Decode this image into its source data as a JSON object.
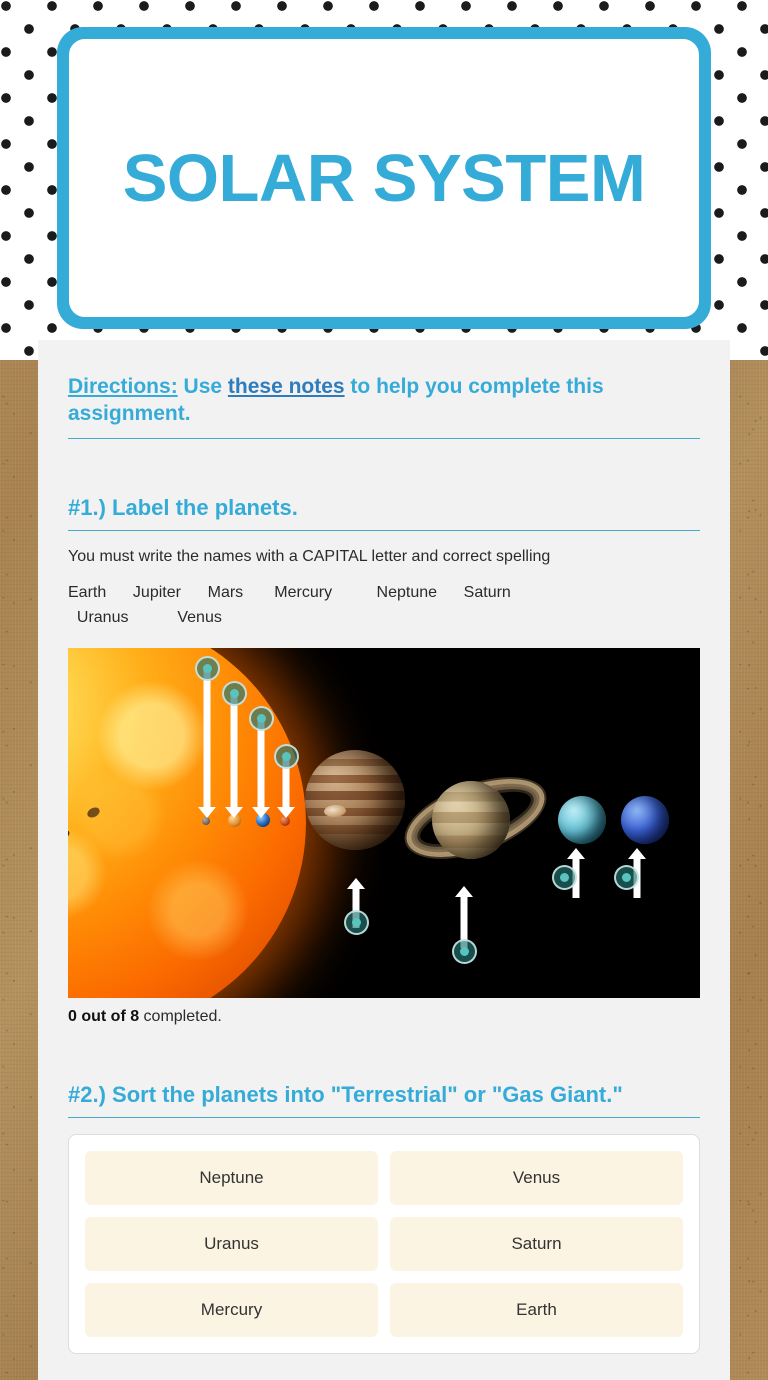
{
  "header": {
    "title": "SOLAR SYSTEM",
    "accent_color": "#35abd8"
  },
  "directions": {
    "label": "Directions:",
    "text_before_link": "Use ",
    "link_text": "these notes",
    "text_after_link": " to help you complete this assignment.",
    "link_color": "#2f7cbd"
  },
  "question1": {
    "title": "#1.) Label the planets.",
    "instruction": "You must write the names with a CAPITAL letter and correct spelling",
    "word_bank": "Earth      Jupiter      Mars       Mercury          Neptune      Saturn\n  Uranus           Venus",
    "progress_count": "0 out of 8",
    "progress_suffix": " completed.",
    "figure": {
      "alt": "solar-system-diagram",
      "bodies": [
        {
          "name": "Sun",
          "kind": "star"
        },
        {
          "name": "Mercury",
          "kind": "terrestrial",
          "marker": "down"
        },
        {
          "name": "Venus",
          "kind": "terrestrial",
          "marker": "down"
        },
        {
          "name": "Earth",
          "kind": "terrestrial",
          "marker": "down"
        },
        {
          "name": "Mars",
          "kind": "terrestrial",
          "marker": "down"
        },
        {
          "name": "Jupiter",
          "kind": "gas-giant",
          "marker": "up"
        },
        {
          "name": "Saturn",
          "kind": "gas-giant",
          "marker": "up"
        },
        {
          "name": "Uranus",
          "kind": "gas-giant",
          "marker": "up"
        },
        {
          "name": "Neptune",
          "kind": "gas-giant",
          "marker": "up"
        }
      ],
      "answer_slots": 8
    }
  },
  "question2": {
    "title": "#2.) Sort the planets into \"Terrestrial\" or \"Gas Giant.\"",
    "tiles": [
      "Neptune",
      "Venus",
      "Uranus",
      "Saturn",
      "Mercury",
      "Earth"
    ]
  }
}
